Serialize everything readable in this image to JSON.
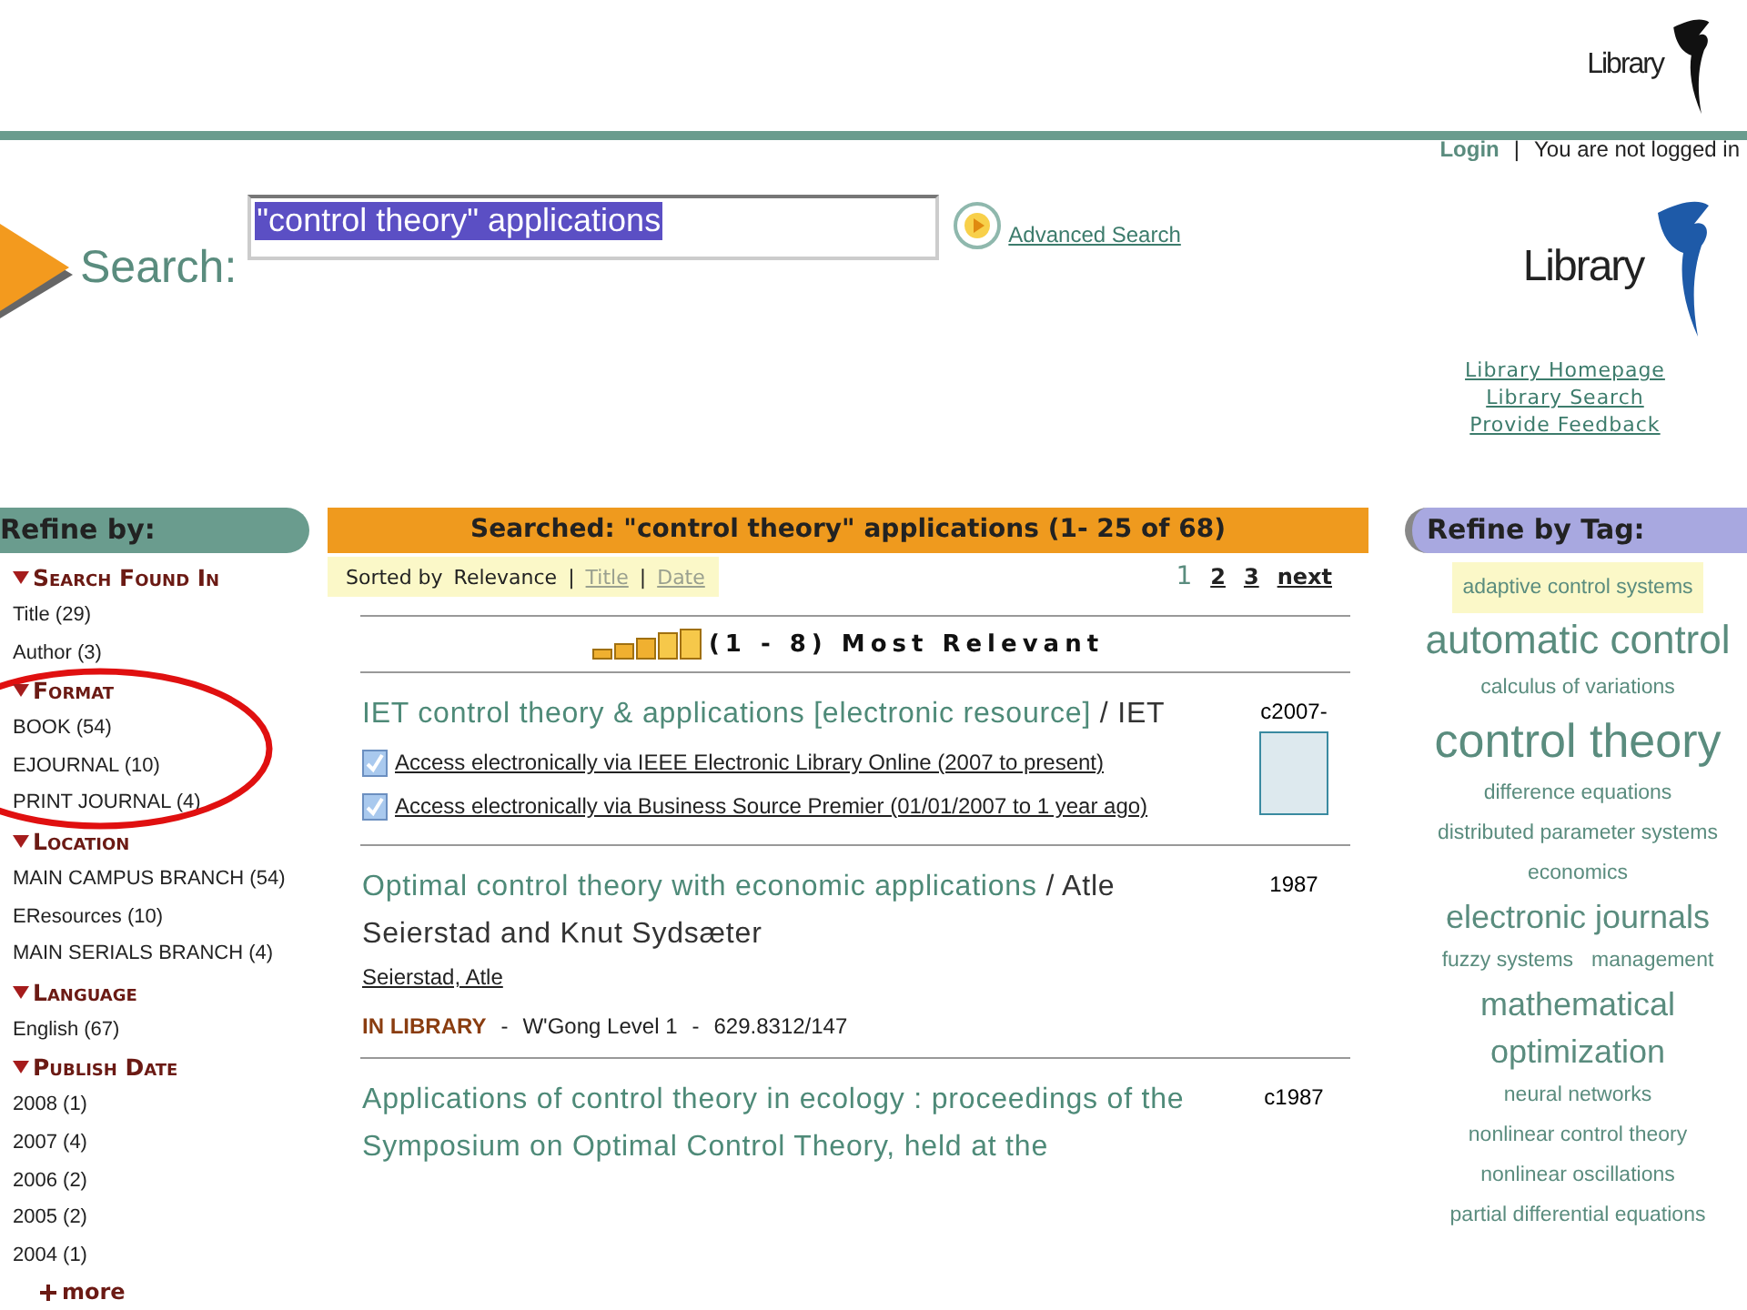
{
  "header": {
    "logo_text": "Library"
  },
  "account": {
    "login": "Login",
    "separator": "|",
    "status": "You are not logged in"
  },
  "search": {
    "label": "Search:",
    "value": "\"control theory\" applications",
    "highlighted": true,
    "advanced_link": "Advanced Search"
  },
  "side_logo": {
    "text": "Library",
    "links": [
      "Library Homepage",
      "Library Search",
      "Provide Feedback"
    ]
  },
  "refine": {
    "title": "Refine by:",
    "groups": [
      {
        "title": "Search Found In",
        "expanded": true,
        "items": [
          "Title (29)",
          "Author (3)"
        ]
      },
      {
        "title": "Format",
        "expanded": true,
        "items": [
          "BOOK (54)",
          "EJOURNAL (10)",
          "PRINT JOURNAL (4)"
        ]
      },
      {
        "title": "Location",
        "expanded": true,
        "items": [
          "MAIN CAMPUS BRANCH (54)",
          "EResources (10)",
          "MAIN SERIALS BRANCH (4)"
        ]
      },
      {
        "title": "Language",
        "expanded": true,
        "items": [
          "English (67)"
        ]
      },
      {
        "title": "Publish Date",
        "expanded": true,
        "items": [
          "2008 (1)",
          "2007 (4)",
          "2006 (2)",
          "2005 (2)",
          "2004 (1)"
        ]
      }
    ],
    "more": "more"
  },
  "results": {
    "heading": "Searched: \"control theory\" applications (1- 25  of 68)",
    "sort_label": "Sorted by",
    "sort_separator": "|",
    "detail_separator": "-",
    "sort_options": [
      {
        "label": "Relevance",
        "selected": true
      },
      {
        "label": "Title",
        "selected": false
      },
      {
        "label": "Date",
        "selected": false
      }
    ],
    "pages": [
      {
        "label": "1",
        "selected": true
      },
      {
        "label": "2",
        "selected": false
      },
      {
        "label": "3",
        "selected": false
      }
    ],
    "next": "next",
    "relevance": "(1 - 8) Most Relevant",
    "items": [
      {
        "title": "IET control theory & applications [electronic resource]",
        "responsibility": "/ IET",
        "date": "c2007-",
        "thumbnail": true,
        "access": [
          {
            "label": "Access electronically via IEEE Electronic Library Online (2007 to present)",
            "checked": true
          },
          {
            "label": "Access electronically via Business Source Premier (01/01/2007 to 1 year ago)",
            "checked": true
          }
        ]
      },
      {
        "title": "Optimal control theory with economic applications",
        "responsibility": "/ Atle Seierstad and Knut Sydsæter",
        "date": "1987",
        "author": "Seierstad, Atle",
        "status": "IN LIBRARY",
        "location": "W'Gong Level 1",
        "call_number": "629.8312/147"
      },
      {
        "title": "Applications of control theory in ecology : proceedings of the Symposium on Optimal Control Theory, held at the",
        "date": "c1987"
      }
    ]
  },
  "tags": {
    "title": "Refine by Tag:",
    "items": [
      {
        "label": "adaptive control systems",
        "kind": "small",
        "highlighted": true
      },
      {
        "label": "automatic control",
        "kind": "large",
        "highlighted": false
      },
      {
        "label": "calculus of variations",
        "kind": "small",
        "highlighted": false
      },
      {
        "label": "control theory",
        "kind": "xlarge",
        "highlighted": false
      },
      {
        "label": "difference equations",
        "kind": "small",
        "highlighted": false
      },
      {
        "label": "distributed parameter systems",
        "kind": "small",
        "highlighted": false
      },
      {
        "label": "economics",
        "kind": "small",
        "highlighted": false
      },
      {
        "label": "electronic journals",
        "kind": "medium",
        "highlighted": false
      },
      {
        "label": "fuzzy systems",
        "kind": "small",
        "highlighted": false
      },
      {
        "label": "management",
        "kind": "small",
        "highlighted": false
      },
      {
        "label": "mathematical optimization",
        "kind": "medium",
        "highlighted": false
      },
      {
        "label": "neural networks",
        "kind": "small",
        "highlighted": false
      },
      {
        "label": "nonlinear control theory",
        "kind": "small",
        "highlighted": false
      },
      {
        "label": "nonlinear oscillations",
        "kind": "small",
        "highlighted": false
      },
      {
        "label": "partial differential equations",
        "kind": "small",
        "highlighted": false
      }
    ]
  }
}
